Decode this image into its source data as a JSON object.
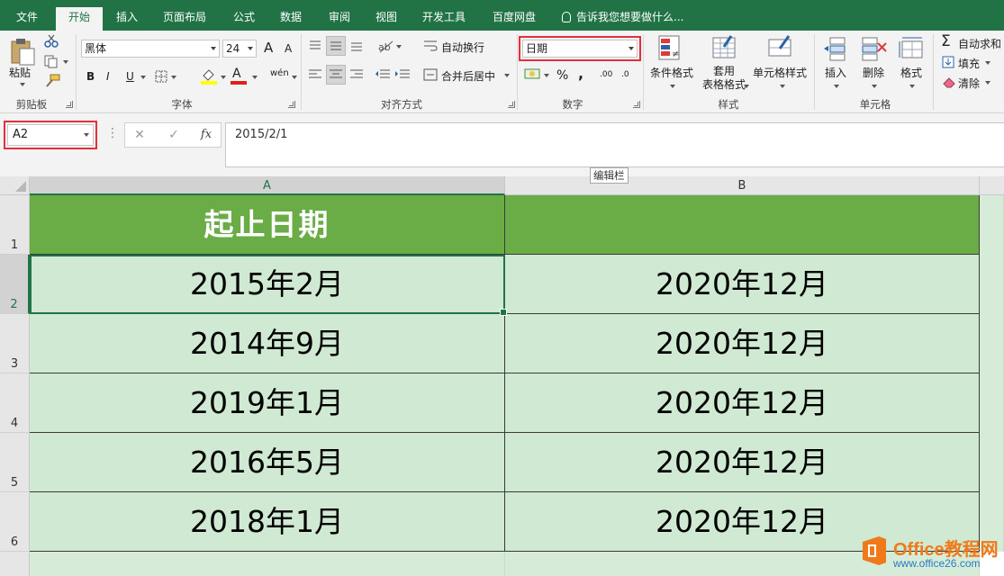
{
  "ribbon_tabs": [
    "文件",
    "开始",
    "插入",
    "页面布局",
    "公式",
    "数据",
    "审阅",
    "视图",
    "开发工具",
    "百度网盘"
  ],
  "active_tab": "开始",
  "tell_me": "告诉我您想要做什么...",
  "clipboard": {
    "paste": "粘贴",
    "group": "剪贴板"
  },
  "font": {
    "name": "黑体",
    "size": "24",
    "bold": "B",
    "italic": "I",
    "underline": "U",
    "font_color_glyph": "A",
    "phonetic": "wén",
    "grow": "A",
    "shrink": "A",
    "group": "字体"
  },
  "alignment": {
    "wrap": "自动换行",
    "merge": "合并后居中",
    "group": "对齐方式"
  },
  "number": {
    "format": "日期",
    "percent": "%",
    "comma": ",",
    "inc_decimal": ".00",
    "dec_decimal": ".0",
    "group": "数字"
  },
  "styles": {
    "conditional": "条件格式",
    "table_format": "套用\n表格格式",
    "cell_styles": "单元格样式",
    "group": "样式"
  },
  "cells": {
    "insert": "插入",
    "delete": "删除",
    "format": "格式",
    "group": "单元格"
  },
  "editing": {
    "autosum": "自动求和",
    "fill": "填充",
    "clear": "清除"
  },
  "formula_bar": {
    "name_box": "A2",
    "cancel": "✕",
    "enter": "✓",
    "fx": "fx",
    "value": "2015/2/1",
    "tooltip": "编辑栏"
  },
  "sheet": {
    "columns": [
      "A",
      "B"
    ],
    "row_numbers": [
      "1",
      "2",
      "3",
      "4",
      "5",
      "6"
    ],
    "header": [
      "起止日期",
      ""
    ],
    "rows": [
      [
        "2015年2月",
        "2020年12月"
      ],
      [
        "2014年9月",
        "2020年12月"
      ],
      [
        "2019年1月",
        "2020年12月"
      ],
      [
        "2016年5月",
        "2020年12月"
      ],
      [
        "2018年1月",
        "2020年12月"
      ]
    ]
  },
  "logo": {
    "brand": "Office教程网",
    "url": "www.office26.com"
  },
  "colors": {
    "ribbon_green": "#217346",
    "header_fill": "#6aac46",
    "data_fill": "#d0e9d3",
    "highlight": "#e0313b"
  }
}
